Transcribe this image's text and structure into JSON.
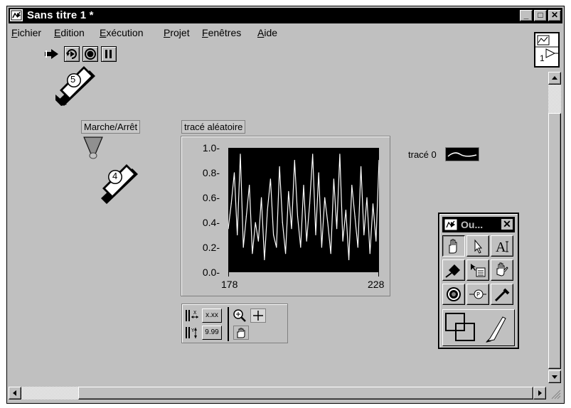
{
  "window": {
    "title": "Sans titre 1 *",
    "minimize": "_",
    "maximize": "□",
    "close": "✕"
  },
  "menu": [
    {
      "first": "F",
      "rest": "ichier"
    },
    {
      "first": "E",
      "rest": "dition"
    },
    {
      "first": "E",
      "rest": "xécution"
    },
    {
      "first": "P",
      "rest": "rojet"
    },
    {
      "first": "F",
      "rest": "enêtres"
    },
    {
      "first": "A",
      "rest": "ide"
    }
  ],
  "toolbar": {
    "icons": [
      "run-arrow-icon",
      "run-continuously-icon",
      "abort-icon",
      "pause-icon"
    ]
  },
  "vi_icon": {
    "number": "1"
  },
  "callouts": {
    "c5": "5",
    "c4": "4"
  },
  "control": {
    "label": "Marche/Arrêt"
  },
  "graph": {
    "label": "tracé aléatoire",
    "legend_label": "tracé 0"
  },
  "chart_data": {
    "type": "line",
    "title": "",
    "xlabel": "",
    "ylabel": "",
    "x_ticks": [
      "178",
      "228"
    ],
    "y_ticks": [
      "1.0-",
      "0.8-",
      "0.6-",
      "0.4-",
      "0.2-",
      "0.0-"
    ],
    "xlim": [
      178,
      228
    ],
    "ylim": [
      0,
      1
    ],
    "series": [
      {
        "name": "tracé 0",
        "color": "#ffffff",
        "x": [
          178,
          179,
          180,
          181,
          182,
          183,
          184,
          185,
          186,
          187,
          188,
          189,
          190,
          191,
          192,
          193,
          194,
          195,
          196,
          197,
          198,
          199,
          200,
          201,
          202,
          203,
          204,
          205,
          206,
          207,
          208,
          209,
          210,
          211,
          212,
          213,
          214,
          215,
          216,
          217,
          218,
          219,
          220,
          221,
          222,
          223,
          224,
          225,
          226,
          227,
          228
        ],
        "y": [
          0.35,
          0.55,
          0.8,
          0.3,
          0.95,
          0.2,
          0.45,
          0.7,
          0.15,
          0.4,
          0.25,
          0.6,
          0.1,
          0.5,
          0.75,
          0.3,
          0.2,
          0.85,
          0.4,
          0.15,
          0.65,
          0.35,
          0.9,
          0.45,
          0.2,
          0.7,
          0.25,
          0.55,
          0.95,
          0.3,
          0.8,
          0.2,
          0.6,
          0.4,
          0.15,
          0.75,
          0.35,
          0.95,
          0.25,
          0.5,
          0.1,
          0.7,
          0.45,
          0.2,
          0.85,
          0.3,
          0.6,
          0.15,
          0.55,
          0.25,
          0.9
        ]
      }
    ]
  },
  "tools_palette": {
    "title": "Ou...",
    "close": "✕"
  },
  "graph_palette": {
    "btn1": "x.xx",
    "btn2": "9.99"
  }
}
